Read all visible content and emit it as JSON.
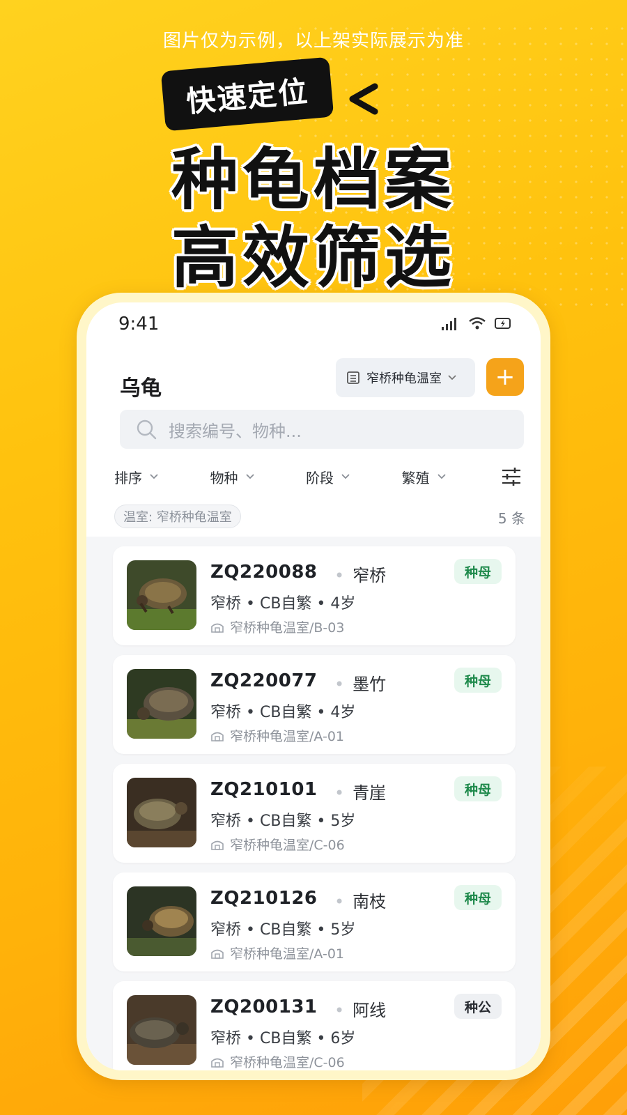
{
  "promo": {
    "disclaimer": "图片仅为示例，以上架实际展示为准",
    "tag": "快速定位",
    "headline_1": "种龟档案",
    "headline_2": "高效筛选"
  },
  "status_bar": {
    "time": "9:41"
  },
  "header": {
    "title": "乌龟",
    "location": "窄桥种龟温室",
    "add_label": "+"
  },
  "search": {
    "placeholder": "搜索编号、物种..."
  },
  "filters": [
    {
      "label": "排序"
    },
    {
      "label": "物种"
    },
    {
      "label": "阶段"
    },
    {
      "label": "繁殖"
    }
  ],
  "active_filter": {
    "chip": "温室: 窄桥种龟温室",
    "count": "5 条"
  },
  "turtles": [
    {
      "code": "ZQ220088",
      "name": "窄桥",
      "meta": "窄桥 • CB自繁 • 4岁",
      "location": "窄桥种龟温室/B-03",
      "role": "种母"
    },
    {
      "code": "ZQ220077",
      "name": "墨竹",
      "meta": "窄桥 • CB自繁 • 4岁",
      "location": "窄桥种龟温室/A-01",
      "role": "种母"
    },
    {
      "code": "ZQ210101",
      "name": "青崖",
      "meta": "窄桥 • CB自繁 • 5岁",
      "location": "窄桥种龟温室/C-06",
      "role": "种母"
    },
    {
      "code": "ZQ210126",
      "name": "南枝",
      "meta": "窄桥 • CB自繁 • 5岁",
      "location": "窄桥种龟温室/A-01",
      "role": "种母"
    },
    {
      "code": "ZQ200131",
      "name": "阿线",
      "meta": "窄桥 • CB自繁 • 6岁",
      "location": "窄桥种龟温室/C-06",
      "role": "种公"
    }
  ],
  "colors": {
    "accent": "#f5a31a",
    "female_badge": "#1f8a4c",
    "background": "#ffc20e"
  }
}
